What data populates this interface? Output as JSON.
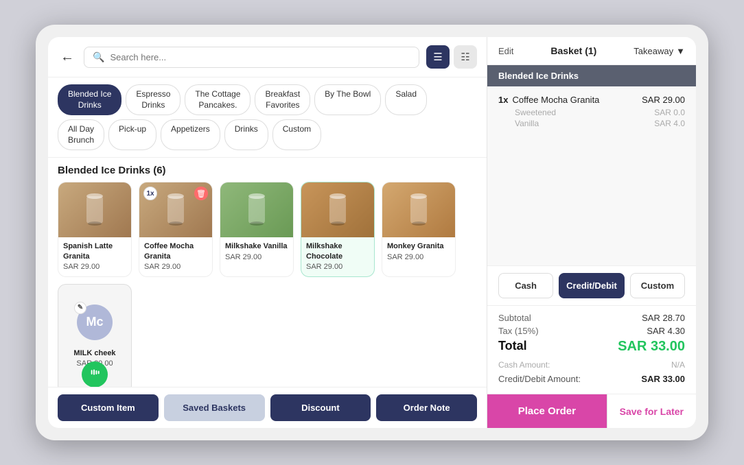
{
  "search": {
    "placeholder": "Search here..."
  },
  "categories": [
    {
      "id": "blended-ice",
      "label": "Blended Ice Drinks",
      "active": true
    },
    {
      "id": "espresso",
      "label": "Espresso Drinks",
      "active": false
    },
    {
      "id": "cottage-pancakes",
      "label": "The Cottage Pancakes.",
      "active": false
    },
    {
      "id": "breakfast",
      "label": "Breakfast Favorites",
      "active": false
    },
    {
      "id": "by-the-bowl",
      "label": "By The Bowl",
      "active": false
    },
    {
      "id": "salad",
      "label": "Salad",
      "active": false
    },
    {
      "id": "all-day-brunch",
      "label": "All Day Brunch",
      "active": false
    },
    {
      "id": "pickup",
      "label": "Pick-up",
      "active": false
    },
    {
      "id": "appetizers",
      "label": "Appetizers",
      "active": false
    },
    {
      "id": "drinks",
      "label": "Drinks",
      "active": false
    },
    {
      "id": "custom",
      "label": "Custom",
      "active": false
    }
  ],
  "section_title": "Blended Ice Drinks (6)",
  "items": [
    {
      "id": "spanish-latte",
      "name": "Spanish Latte Granita",
      "price": "SAR 29.00",
      "color": "coffee",
      "badge": null
    },
    {
      "id": "coffee-mocha",
      "name": "Coffee Mocha Granita",
      "price": "SAR 29.00",
      "color": "coffee",
      "badge": "1x",
      "has_delete": true
    },
    {
      "id": "milkshake-vanilla",
      "name": "Milkshake Vanilla",
      "price": "SAR 29.00",
      "color": "matcha",
      "badge": null
    },
    {
      "id": "milkshake-choco",
      "name": "Milkshake Chocolate",
      "price": "SAR 29.00",
      "color": "choco",
      "badge": null,
      "selected": true
    },
    {
      "id": "monkey-granita",
      "name": "Monkey Granita",
      "price": "SAR 29.00",
      "color": "granita",
      "badge": null
    }
  ],
  "custom_item": {
    "initials": "Mc",
    "name": "MILK cheek",
    "price": "SAR 30.00"
  },
  "bottom_actions": [
    {
      "id": "custom-item",
      "label": "Custom Item",
      "style": "dark"
    },
    {
      "id": "saved-baskets",
      "label": "Saved Baskets",
      "style": "light"
    },
    {
      "id": "discount",
      "label": "Discount",
      "style": "dark"
    },
    {
      "id": "order-note",
      "label": "Order Note",
      "style": "dark"
    }
  ],
  "right": {
    "edit_label": "Edit",
    "basket_label": "Basket (1)",
    "takeaway_label": "Takeaway",
    "section_label": "Blended Ice Drinks",
    "basket_items": [
      {
        "qty": "1x",
        "name": "Coffee Mocha Granita",
        "price": "SAR 29.00",
        "modifiers": [
          {
            "name": "Sweetened",
            "price": "SAR 0.0"
          },
          {
            "name": "Vanilla",
            "price": "SAR 4.0"
          }
        ]
      }
    ],
    "payment_buttons": [
      {
        "id": "cash",
        "label": "Cash",
        "active": false
      },
      {
        "id": "credit-debit",
        "label": "Credit/Debit",
        "active": true
      },
      {
        "id": "custom",
        "label": "Custom",
        "active": false
      }
    ],
    "subtotal_label": "Subtotal",
    "subtotal_value": "SAR 28.70",
    "tax_label": "Tax (15%)",
    "tax_value": "SAR 4.30",
    "total_label": "Total",
    "total_value": "SAR 33.00",
    "cash_amount_label": "Cash Amount:",
    "cash_amount_value": "N/A",
    "credit_label": "Credit/Debit Amount:",
    "credit_value": "SAR 33.00",
    "place_order_label": "Place Order",
    "save_later_label": "Save for Later"
  }
}
